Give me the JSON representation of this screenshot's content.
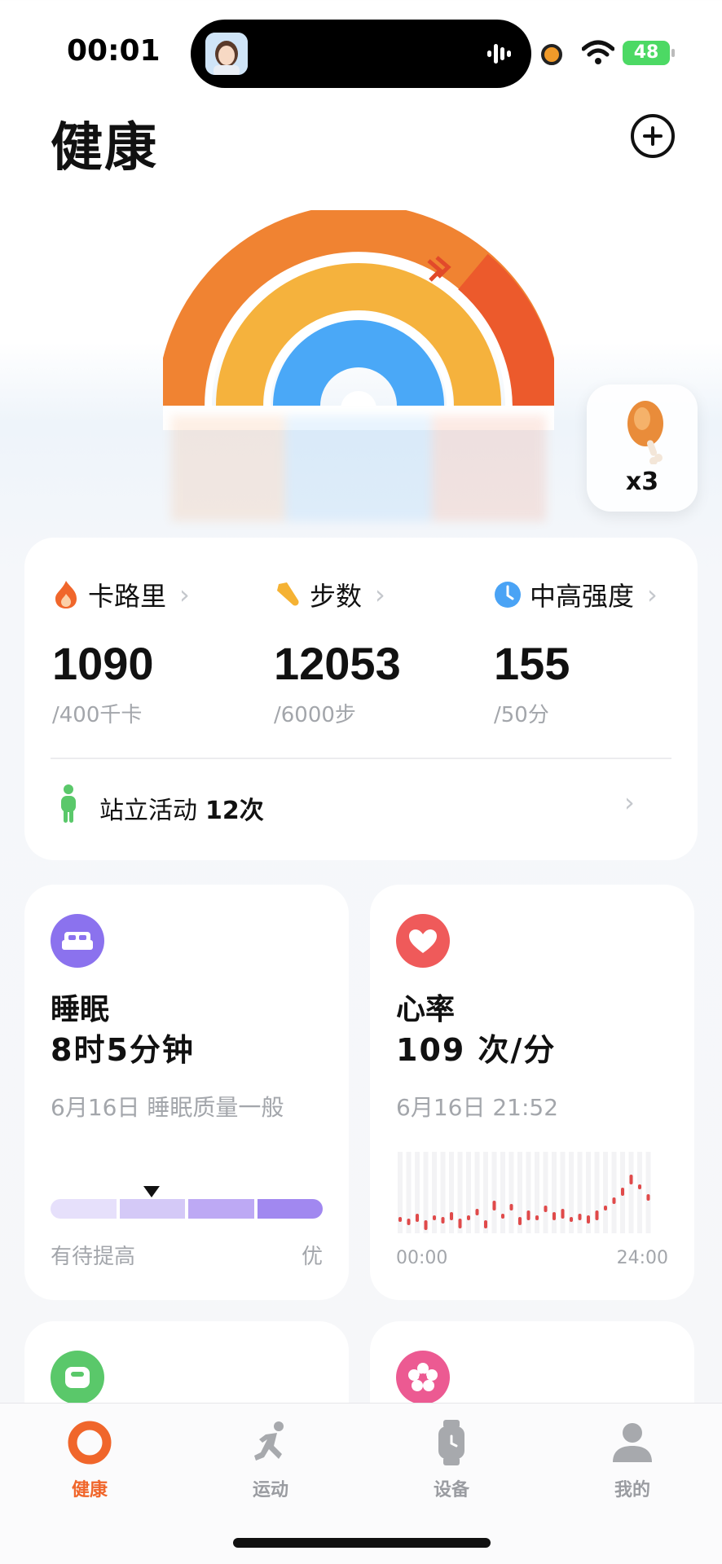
{
  "status_bar": {
    "time": "00:01",
    "battery": "48"
  },
  "header": {
    "title": "健康"
  },
  "reward": {
    "count": "x3"
  },
  "activity": {
    "metrics": [
      {
        "label": "卡路里",
        "value": "1090",
        "goal": "/400千卡",
        "icon": "flame-icon",
        "color": "#f0662b"
      },
      {
        "label": "步数",
        "value": "12053",
        "goal": "/6000步",
        "icon": "shoe-icon",
        "color": "#f5b233"
      },
      {
        "label": "中高强度",
        "value": "155",
        "goal": "/50分",
        "icon": "clock-icon",
        "color": "#4aa3f5"
      }
    ],
    "stand": {
      "label": "站立活动",
      "value": "12次"
    }
  },
  "sleep": {
    "title": "睡眠",
    "value": "8时5分钟",
    "sub": "6月16日 睡眠质量一般",
    "scale_low": "有待提高",
    "scale_high": "优",
    "quality_level": 0.37
  },
  "heart": {
    "title": "心率",
    "value": "109 次/分",
    "sub": "6月16日 21:52",
    "x_start": "00:00",
    "x_end": "24:00"
  },
  "tabs": [
    {
      "label": "健康",
      "icon": "ring-icon",
      "active": true
    },
    {
      "label": "运动",
      "icon": "runner-icon",
      "active": false
    },
    {
      "label": "设备",
      "icon": "watch-icon",
      "active": false
    },
    {
      "label": "我的",
      "icon": "person-icon",
      "active": false
    }
  ],
  "colors": {
    "accent": "#f0662b",
    "ring_outer": "#f08332",
    "ring_outer_over": "#ec5a2c",
    "ring_middle": "#f5b23d",
    "ring_inner": "#4aa8f7",
    "sleep": "#8b72ee",
    "heart": "#ef5a5a",
    "stand": "#5ac86a"
  }
}
